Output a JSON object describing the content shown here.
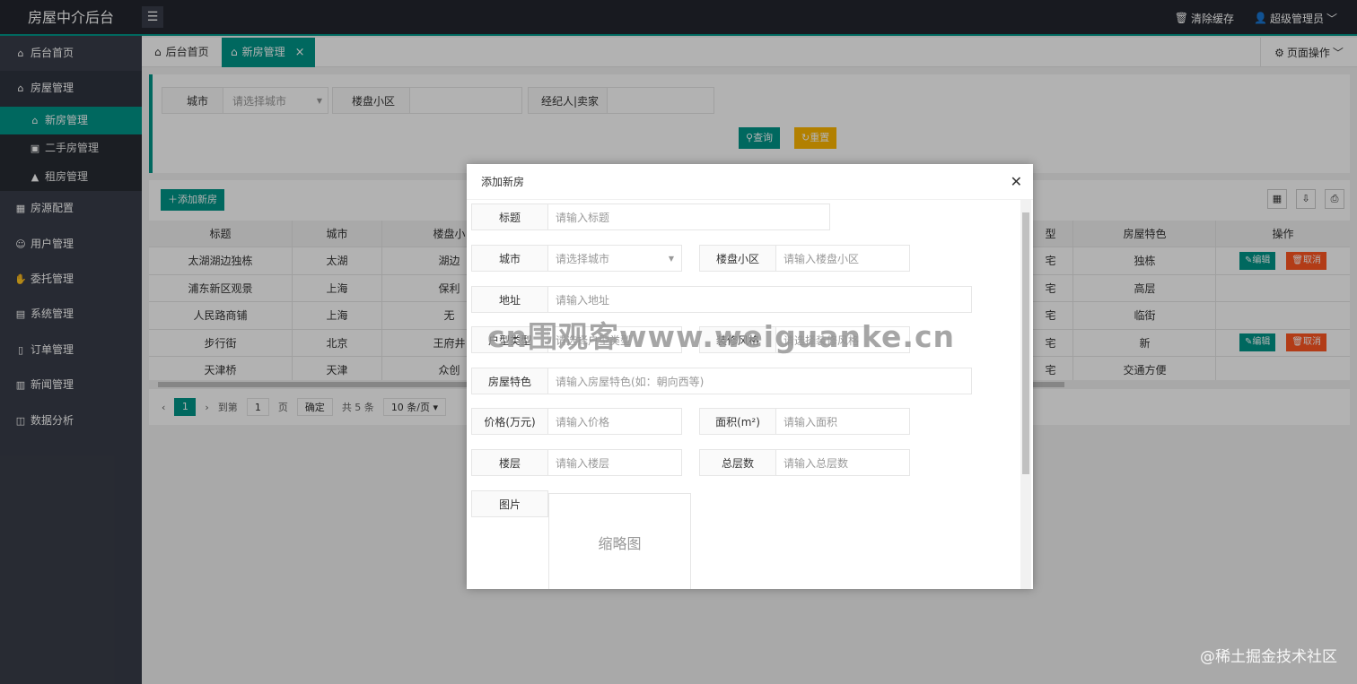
{
  "header": {
    "title": "房屋中介后台",
    "menu_icon": "hamburger-icon",
    "clear_cache": "清除缓存",
    "user": "超级管理员"
  },
  "sidebar": {
    "items": [
      {
        "label": "后台首页",
        "icon": "home-icon"
      },
      {
        "label": "房屋管理",
        "icon": "house-icon"
      },
      {
        "label": "房源配置",
        "icon": "grid-icon"
      },
      {
        "label": "用户管理",
        "icon": "user-icon"
      },
      {
        "label": "委托管理",
        "icon": "entrust-icon"
      },
      {
        "label": "系统管理",
        "icon": "system-icon"
      },
      {
        "label": "订单管理",
        "icon": "order-icon"
      },
      {
        "label": "新闻管理",
        "icon": "news-icon"
      },
      {
        "label": "数据分析",
        "icon": "chart-icon"
      }
    ],
    "sub": [
      "新房管理",
      "二手房管理",
      "租房管理"
    ]
  },
  "tabs": {
    "home": "后台首页",
    "active": "新房管理",
    "page_ops": "页面操作"
  },
  "search": {
    "city_label": "城市",
    "city_placeholder": "请选择城市",
    "estate_label": "楼盘小区",
    "agent_label": "经纪人|卖家",
    "query": "查询",
    "reset": "重置"
  },
  "toolbar": {
    "add": "添加新房"
  },
  "table": {
    "headers": [
      "标题",
      "城市",
      "楼盘小",
      "型",
      "房屋特色"
    ],
    "op_header": "操作",
    "rows": [
      [
        "太湖湖边独栋",
        "太湖",
        "湖边",
        "宅",
        "独栋"
      ],
      [
        "浦东新区观景",
        "上海",
        "保利",
        "宅",
        "高层"
      ],
      [
        "人民路商铺",
        "上海",
        "无",
        "宅",
        "临街"
      ],
      [
        "步行街",
        "北京",
        "王府井",
        "宅",
        "新"
      ],
      [
        "天津桥",
        "天津",
        "众创",
        "宅",
        "交通方便"
      ]
    ],
    "edit": "编辑",
    "delete": "取消"
  },
  "pager": {
    "current": "1",
    "goto": "到第",
    "page_input": "1",
    "page_unit": "页",
    "confirm": "确定",
    "total": "共 5 条",
    "page_size": "10 条/页"
  },
  "modal": {
    "title": "添加新房",
    "fields": {
      "title_label": "标题",
      "title_ph": "请输入标题",
      "city_label": "城市",
      "city_ph": "请选择城市",
      "estate_label": "楼盘小区",
      "estate_ph": "请输入楼盘小区",
      "addr_label": "地址",
      "addr_ph": "请输入地址",
      "type_label": "户型类型",
      "type_ph": "请选择户型类型",
      "deco_label": "装修风格",
      "deco_ph": "请选择装修风格",
      "feat_label": "房屋特色",
      "feat_ph": "请输入房屋特色(如：朝向西等)",
      "price_label": "价格(万元)",
      "price_ph": "请输入价格",
      "area_label": "面积(m²)",
      "area_ph": "请输入面积",
      "floor_label": "楼层",
      "floor_ph": "请输入楼层",
      "total_label": "总层数",
      "total_ph": "请输入总层数",
      "img_label": "图片",
      "thumb": "缩略图"
    }
  },
  "watermark": "cn围观客www.weiguanke.cn",
  "credit": "@稀土掘金技术社区"
}
